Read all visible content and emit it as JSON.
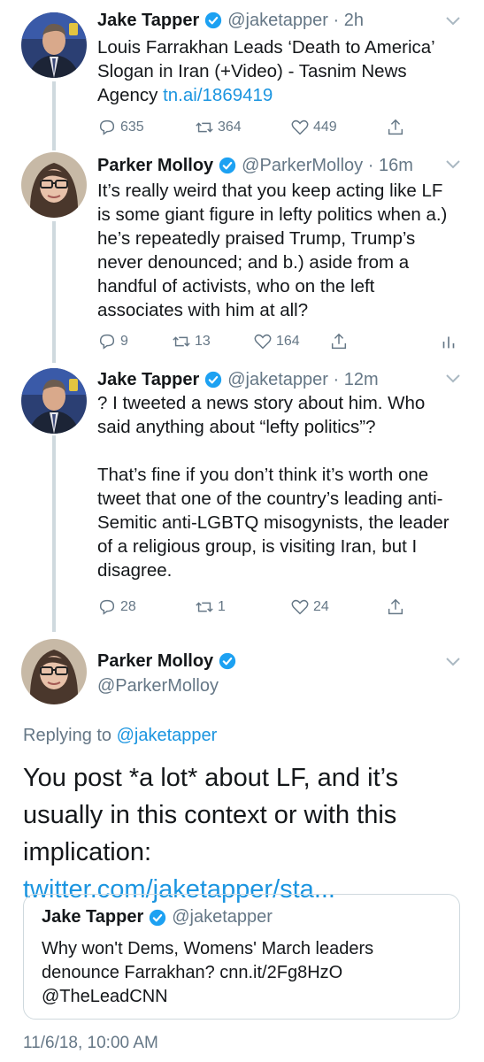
{
  "colors": {
    "link": "#1b95e0",
    "secondary": "#657786",
    "verified": "#1da1f2",
    "thread_line": "#cfd9de"
  },
  "tweets": [
    {
      "name": "Jake Tapper",
      "handle": "@jaketapper",
      "time": "2h",
      "text": "Louis Farrakhan Leads ‘Death to America’ Slogan in Iran (+Video) - Tasnim News Agency ",
      "link": "tn.ai/1869419",
      "replies": "635",
      "retweets": "364",
      "likes": "449"
    },
    {
      "name": "Parker Molloy",
      "handle": "@ParkerMolloy",
      "time": "16m",
      "text": "It’s really weird that you keep acting like LF is some giant figure in lefty politics when a.) he’s repeatedly praised Trump, Trump’s never denounced; and b.) aside from a handful of activists, who on the left associates with him at all?",
      "replies": "9",
      "retweets": "13",
      "likes": "164"
    },
    {
      "name": "Jake Tapper",
      "handle": "@jaketapper",
      "time": "12m",
      "text": "? I tweeted a news story about him. Who said anything about “lefty politics”?\n\nThat’s fine if you don’t think it’s worth one tweet that one of the country’s leading anti-Semitic anti-LGBTQ misogynists, the leader of a religious group, is visiting Iran, but I disagree.",
      "replies": "28",
      "retweets": "1",
      "likes": "24"
    }
  ],
  "focused": {
    "name": "Parker Molloy",
    "handle": "@ParkerMolloy",
    "replying_prefix": "Replying to ",
    "replying_to": "@jaketapper",
    "text": "You post *a lot* about LF, and it’s usually in this context or with this implication: ",
    "link": "twitter.com/jaketapper/sta...",
    "quote": {
      "name": "Jake Tapper",
      "handle": "@jaketapper",
      "text": "Why won't Dems, Womens' March leaders denounce Farrakhan? cnn.it/2Fg8HzO @TheLeadCNN"
    },
    "timestamp": "11/6/18, 10:00 AM"
  },
  "icons": [
    "reply-icon",
    "retweet-icon",
    "like-icon",
    "share-icon",
    "analytics-icon",
    "verified-icon",
    "chevron-down-icon"
  ]
}
